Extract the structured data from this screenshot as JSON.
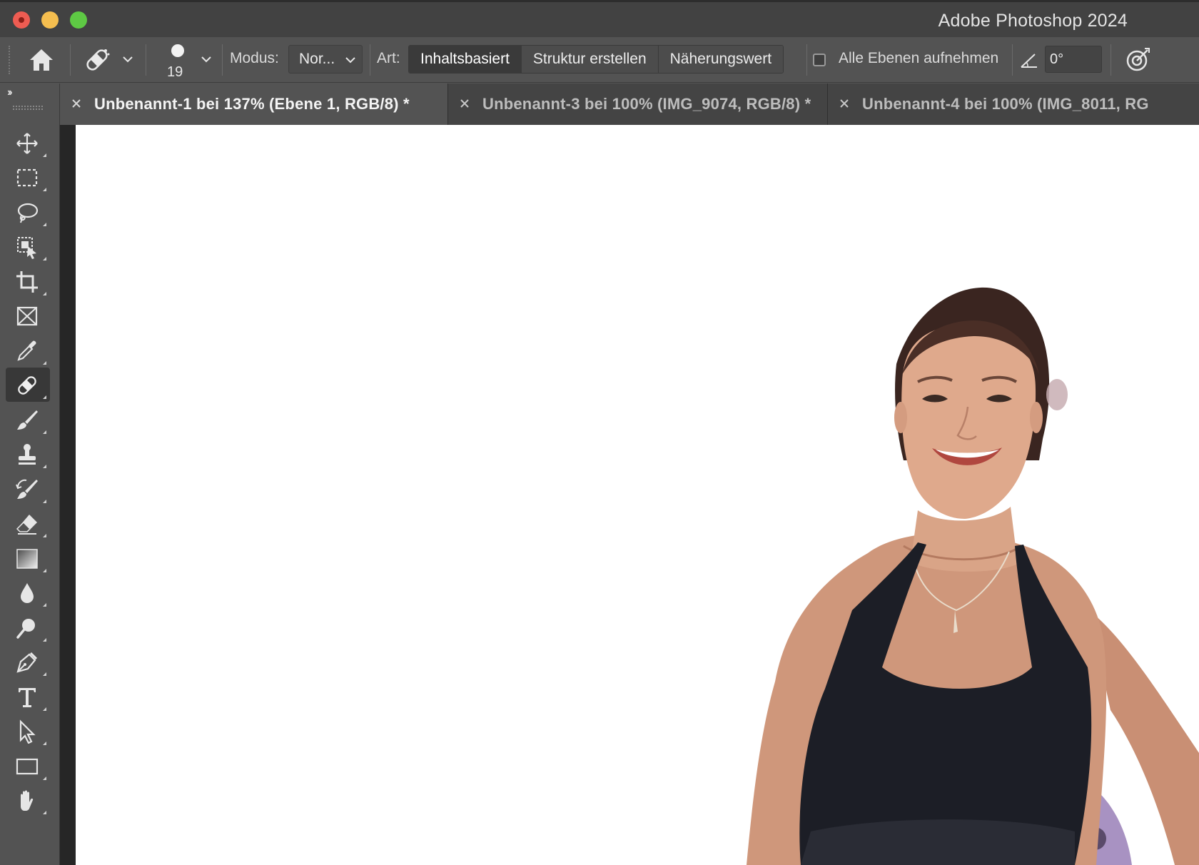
{
  "window": {
    "title": "Adobe Photoshop 2024"
  },
  "options_bar": {
    "brush_size": "19",
    "mode_label": "Modus:",
    "mode_value": "Nor...",
    "type_label": "Art:",
    "type_options": [
      {
        "label": "Inhaltsbasiert",
        "selected": true
      },
      {
        "label": "Struktur erstellen",
        "selected": false
      },
      {
        "label": "Näherungswert",
        "selected": false
      }
    ],
    "sample_all_layers_label": "Alle Ebenen aufnehmen",
    "sample_all_layers_checked": false,
    "angle_value": "0°"
  },
  "tabs": [
    {
      "label": "Unbenannt-1 bei 137% (Ebene 1, RGB/8) *",
      "active": true
    },
    {
      "label": "Unbenannt-3 bei 100% (IMG_9074, RGB/8) *",
      "active": false
    },
    {
      "label": "Unbenannt-4 bei 100% (IMG_8011, RG",
      "active": false
    }
  ],
  "tools": [
    {
      "name": "move-tool",
      "icon": "move-icon"
    },
    {
      "name": "rectangular-marquee-tool",
      "icon": "marquee-icon"
    },
    {
      "name": "lasso-tool",
      "icon": "lasso-icon"
    },
    {
      "name": "object-selection-tool",
      "icon": "object-selection-icon"
    },
    {
      "name": "crop-tool",
      "icon": "crop-icon"
    },
    {
      "name": "frame-tool",
      "icon": "frame-icon"
    },
    {
      "name": "eyedropper-tool",
      "icon": "eyedropper-icon"
    },
    {
      "name": "spot-healing-brush-tool",
      "icon": "bandage-icon",
      "active": true
    },
    {
      "name": "brush-tool",
      "icon": "brush-icon"
    },
    {
      "name": "clone-stamp-tool",
      "icon": "stamp-icon"
    },
    {
      "name": "history-brush-tool",
      "icon": "history-brush-icon"
    },
    {
      "name": "eraser-tool",
      "icon": "eraser-icon"
    },
    {
      "name": "gradient-tool",
      "icon": "gradient-icon"
    },
    {
      "name": "blur-tool",
      "icon": "drop-icon"
    },
    {
      "name": "dodge-tool",
      "icon": "dodge-icon"
    },
    {
      "name": "pen-tool",
      "icon": "pen-icon"
    },
    {
      "name": "type-tool",
      "icon": "type-icon"
    },
    {
      "name": "path-selection-tool",
      "icon": "arrow-icon"
    },
    {
      "name": "rectangle-tool",
      "icon": "rectangle-icon"
    },
    {
      "name": "hand-tool",
      "icon": "hand-icon"
    }
  ],
  "colors": {
    "ui_dark": "#535353",
    "titlebar": "#424242",
    "canvas": "#ffffff"
  }
}
